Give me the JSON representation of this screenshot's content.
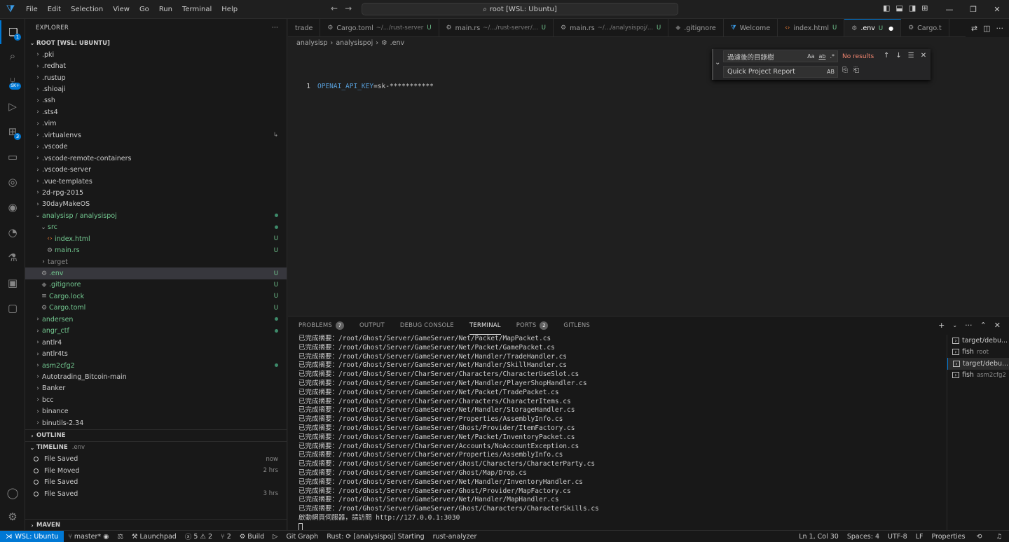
{
  "titlebar": {
    "menus": [
      "File",
      "Edit",
      "Selection",
      "View",
      "Go",
      "Run",
      "Terminal",
      "Help"
    ],
    "command_center": "root [WSL: Ubuntu]"
  },
  "activity": {
    "explorer_badge": "1",
    "accounts_badge": "SK+",
    "extensions_badge": "3"
  },
  "sidebar": {
    "title": "EXPLORER",
    "root_label": "ROOT [WSL: UBUNTU]",
    "tree": [
      {
        "label": ".pki",
        "indent": 0,
        "kind": "folder",
        "chev": "›"
      },
      {
        "label": ".redhat",
        "indent": 0,
        "kind": "folder",
        "chev": "›"
      },
      {
        "label": ".rustup",
        "indent": 0,
        "kind": "folder",
        "chev": "›"
      },
      {
        "label": ".shioaji",
        "indent": 0,
        "kind": "folder",
        "chev": "›"
      },
      {
        "label": ".ssh",
        "indent": 0,
        "kind": "folder",
        "chev": "›"
      },
      {
        "label": ".sts4",
        "indent": 0,
        "kind": "folder",
        "chev": "›"
      },
      {
        "label": ".vim",
        "indent": 0,
        "kind": "folder",
        "chev": "›"
      },
      {
        "label": ".virtualenvs",
        "indent": 0,
        "kind": "folder",
        "chev": "›",
        "status": "↳"
      },
      {
        "label": ".vscode",
        "indent": 0,
        "kind": "folder",
        "chev": "›"
      },
      {
        "label": ".vscode-remote-containers",
        "indent": 0,
        "kind": "folder",
        "chev": "›"
      },
      {
        "label": ".vscode-server",
        "indent": 0,
        "kind": "folder",
        "chev": "›"
      },
      {
        "label": ".vue-templates",
        "indent": 0,
        "kind": "folder",
        "chev": "›"
      },
      {
        "label": "2d-rpg-2015",
        "indent": 0,
        "kind": "folder",
        "chev": "›"
      },
      {
        "label": "30dayMakeOS",
        "indent": 0,
        "kind": "folder",
        "chev": "›"
      },
      {
        "label": "analysisp / analysispoj",
        "indent": 0,
        "kind": "folder-open",
        "chev": "⌄",
        "status": "dot",
        "color": "green"
      },
      {
        "label": "src",
        "indent": 1,
        "kind": "folder-open",
        "chev": "⌄",
        "status": "dot",
        "color": "green"
      },
      {
        "label": "index.html",
        "indent": 2,
        "kind": "html",
        "status": "U",
        "color": "green"
      },
      {
        "label": "main.rs",
        "indent": 2,
        "kind": "rust",
        "status": "U",
        "color": "green"
      },
      {
        "label": "target",
        "indent": 1,
        "kind": "folder",
        "chev": "›",
        "color": "muted"
      },
      {
        "label": ".env",
        "indent": 1,
        "kind": "gear",
        "status": "U",
        "color": "green",
        "selected": true
      },
      {
        "label": ".gitignore",
        "indent": 1,
        "kind": "git",
        "status": "U",
        "color": "green"
      },
      {
        "label": "Cargo.lock",
        "indent": 1,
        "kind": "lines",
        "status": "U",
        "color": "green"
      },
      {
        "label": "Cargo.toml",
        "indent": 1,
        "kind": "gear",
        "status": "U",
        "color": "green"
      },
      {
        "label": "andersen",
        "indent": 0,
        "kind": "folder",
        "chev": "›",
        "status": "dot",
        "color": "green"
      },
      {
        "label": "angr_ctf",
        "indent": 0,
        "kind": "folder",
        "chev": "›",
        "status": "dot",
        "color": "green"
      },
      {
        "label": "antlr4",
        "indent": 0,
        "kind": "folder",
        "chev": "›"
      },
      {
        "label": "antlr4ts",
        "indent": 0,
        "kind": "folder",
        "chev": "›"
      },
      {
        "label": "asm2cfg2",
        "indent": 0,
        "kind": "folder",
        "chev": "›",
        "status": "dot",
        "color": "green"
      },
      {
        "label": "Autotrading_Bitcoin-main",
        "indent": 0,
        "kind": "folder",
        "chev": "›"
      },
      {
        "label": "Banker",
        "indent": 0,
        "kind": "folder",
        "chev": "›"
      },
      {
        "label": "bcc",
        "indent": 0,
        "kind": "folder",
        "chev": "›"
      },
      {
        "label": "binance",
        "indent": 0,
        "kind": "folder",
        "chev": "›"
      },
      {
        "label": "binutils-2.34",
        "indent": 0,
        "kind": "folder",
        "chev": "›"
      }
    ],
    "outline_label": "OUTLINE",
    "timeline_label": "TIMELINE",
    "timeline_file": ".env",
    "timeline": [
      {
        "label": "File Saved",
        "when": "now"
      },
      {
        "label": "File Moved",
        "when": "2 hrs"
      },
      {
        "label": "File Saved",
        "when": ""
      },
      {
        "label": "File Saved",
        "when": "3 hrs"
      }
    ],
    "maven_label": "MAVEN"
  },
  "tabs": [
    {
      "label": "trade",
      "path": "",
      "status": "",
      "icon": ""
    },
    {
      "label": "Cargo.toml",
      "path": "~/.../rust-server",
      "status": "U",
      "icon": "gear"
    },
    {
      "label": "main.rs",
      "path": "~/.../rust-server/...",
      "status": "U",
      "icon": "rust"
    },
    {
      "label": "main.rs",
      "path": "~/.../analysispoj/...",
      "status": "U",
      "icon": "rust"
    },
    {
      "label": ".gitignore",
      "path": "",
      "status": "",
      "icon": "git"
    },
    {
      "label": "Welcome",
      "path": "",
      "status": "",
      "icon": "vscode"
    },
    {
      "label": "index.html",
      "path": "",
      "status": "U",
      "icon": "html"
    },
    {
      "label": ".env",
      "path": "",
      "status": "U",
      "icon": "gear",
      "active": true
    },
    {
      "label": "Cargo.t",
      "path": "",
      "status": "",
      "icon": "gear"
    }
  ],
  "breadcrumb": [
    "analysisp",
    "analysispoj",
    ".env"
  ],
  "editor": {
    "line_number": "1",
    "code_key": "OPENAI_API_KEY",
    "code_rest": "=sk-***********"
  },
  "find": {
    "search_value": "過濾後的目錄樹",
    "replace_value": "Quick Project Report",
    "no_results": "No results",
    "opt_case": "Aa",
    "opt_word": "ab",
    "opt_regex": ".*",
    "opt_preserve": "AB"
  },
  "panel": {
    "tabs": [
      {
        "label": "PROBLEMS",
        "badge": "7"
      },
      {
        "label": "OUTPUT",
        "badge": ""
      },
      {
        "label": "DEBUG CONSOLE",
        "badge": ""
      },
      {
        "label": "TERMINAL",
        "badge": "",
        "active": true
      },
      {
        "label": "PORTS",
        "badge": "2"
      },
      {
        "label": "GITLENS",
        "badge": ""
      }
    ],
    "terminal_lines": [
      "已完成摘要：/root/Ghost/Server/GameServer/Net/Packet/MapPacket.cs",
      "已完成摘要：/root/Ghost/Server/GameServer/Net/Packet/GamePacket.cs",
      "已完成摘要：/root/Ghost/Server/GameServer/Net/Handler/TradeHandler.cs",
      "已完成摘要：/root/Ghost/Server/GameServer/Net/Handler/SkillHandler.cs",
      "已完成摘要：/root/Ghost/Server/CharServer/Characters/CharacterUseSlot.cs",
      "已完成摘要：/root/Ghost/Server/GameServer/Net/Handler/PlayerShopHandler.cs",
      "已完成摘要：/root/Ghost/Server/GameServer/Net/Packet/TradePacket.cs",
      "已完成摘要：/root/Ghost/Server/CharServer/Characters/CharacterItems.cs",
      "已完成摘要：/root/Ghost/Server/GameServer/Net/Handler/StorageHandler.cs",
      "已完成摘要：/root/Ghost/Server/GameServer/Properties/AssemblyInfo.cs",
      "已完成摘要：/root/Ghost/Server/GameServer/Ghost/Provider/ItemFactory.cs",
      "已完成摘要：/root/Ghost/Server/GameServer/Net/Packet/InventoryPacket.cs",
      "已完成摘要：/root/Ghost/Server/CharServer/Accounts/NoAccountException.cs",
      "已完成摘要：/root/Ghost/Server/CharServer/Properties/AssemblyInfo.cs",
      "已完成摘要：/root/Ghost/Server/GameServer/Ghost/Characters/CharacterParty.cs",
      "已完成摘要：/root/Ghost/Server/GameServer/Ghost/Map/Drop.cs",
      "已完成摘要：/root/Ghost/Server/GameServer/Net/Handler/InventoryHandler.cs",
      "已完成摘要：/root/Ghost/Server/GameServer/Ghost/Provider/MapFactory.cs",
      "已完成摘要：/root/Ghost/Server/GameServer/Net/Handler/MapHandler.cs",
      "已完成摘要：/root/Ghost/Server/GameServer/Ghost/Characters/CharacterSkills.cs",
      "啟動網頁伺服器，請訪問 http://127.0.0.1:3030"
    ],
    "terminal_list": [
      {
        "label": "target/debu...",
        "sub": ""
      },
      {
        "label": "fish",
        "sub": "root"
      },
      {
        "label": "target/debu...",
        "sub": "",
        "selected": true
      },
      {
        "label": "fish",
        "sub": "asm2cfg2"
      }
    ]
  },
  "status": {
    "remote": "WSL: Ubuntu",
    "branch": "master*",
    "errors": "5",
    "warnings": "2",
    "ports": "2",
    "build": "Build",
    "launchpad": "Launchpad",
    "git_graph": "Git Graph",
    "rust": "Rust:",
    "rust_status": "[analysispoj] Starting",
    "rust_analyzer": "rust-analyzer",
    "position": "Ln 1, Col 30",
    "spaces": "Spaces: 4",
    "encoding": "UTF-8",
    "eol": "LF",
    "properties": "Properties"
  }
}
